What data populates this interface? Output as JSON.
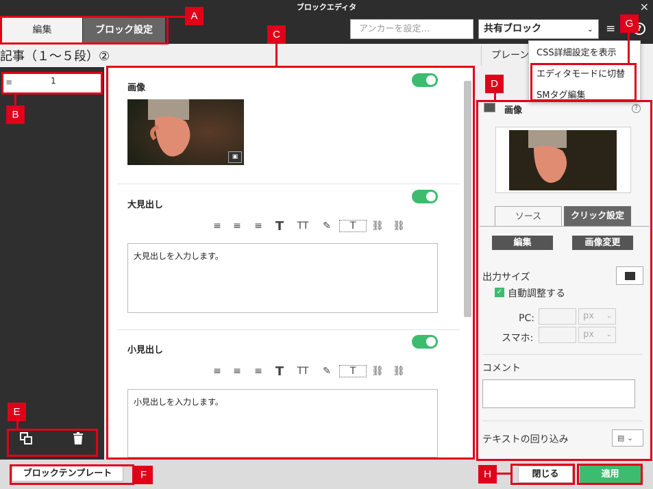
{
  "window": {
    "title": "ブロックエディタ",
    "close_glyph": "✕"
  },
  "tabs": {
    "edit": "編集",
    "block_settings": "ブロック設定"
  },
  "header": {
    "anchor_placeholder": "アンカーを設定…",
    "shared_block": "共有ブロック",
    "menu_glyph": "≡",
    "help_glyph": "?"
  },
  "page": {
    "title": "記事（１～５段）②",
    "preview_tab": "プレーン"
  },
  "sidebar": {
    "item_number": "1",
    "handle_glyph": "≡"
  },
  "sections": [
    {
      "title": "画像"
    },
    {
      "title": "大見出し",
      "text": "大見出しを入力します。"
    },
    {
      "title": "小見出し",
      "text": "小見出しを入力します。"
    }
  ],
  "toolbar_glyphs": [
    "≡",
    "≡",
    "≡",
    "T",
    "TT",
    "✎",
    "T",
    "⛓",
    "⛓"
  ],
  "right_panel": {
    "title": "画像",
    "tab_source": "ソース",
    "tab_click": "クリック設定",
    "edit_button": "編集",
    "change_image_button": "画像変更",
    "output_size_label": "出力サイズ",
    "auto_adjust_label": "自動調整する",
    "pc_label": "PC:",
    "mobile_label": "スマホ:",
    "unit": "px",
    "comment_label": "コメント",
    "text_wrap_label": "テキストの回り込み"
  },
  "dropdown_menu": [
    "CSS詳細設定を表示",
    "エディタモードに切替",
    "SMタグ編集"
  ],
  "footer": {
    "template_button": "ブロックテンプレート",
    "close_button": "閉じる",
    "apply_button": "適用"
  },
  "callouts": [
    "A",
    "B",
    "C",
    "D",
    "E",
    "F",
    "G",
    "H"
  ],
  "colors": {
    "accent_green": "#3dbc70",
    "annotation_red": "#e0001a",
    "dark_bg": "#2d2d2d"
  }
}
